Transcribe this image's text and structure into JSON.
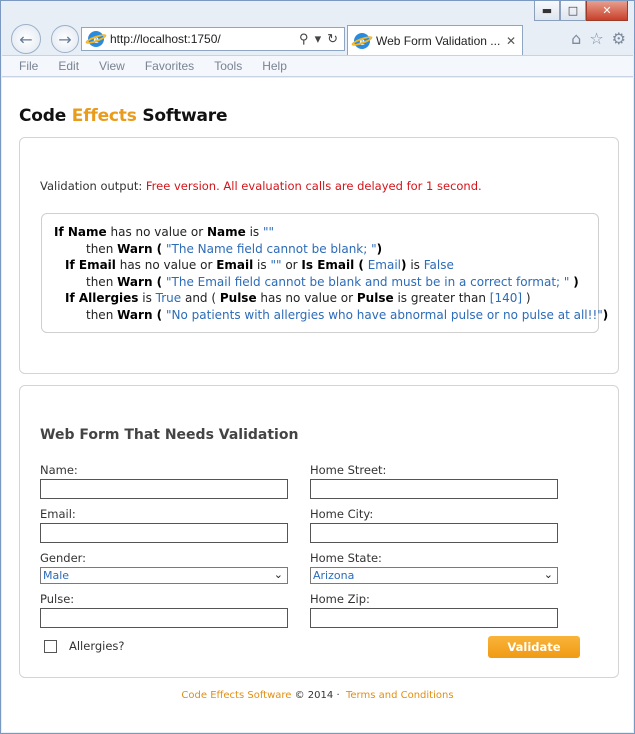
{
  "browser": {
    "url": "http://localhost:1750/",
    "tab_title": "Web Form Validation ...",
    "menu": [
      "File",
      "Edit",
      "View",
      "Favorites",
      "Tools",
      "Help"
    ]
  },
  "brand": {
    "part1": "Code ",
    "part2": "Effects",
    "part3": " Software"
  },
  "validation": {
    "label": "Validation output:",
    "message": "Free version. All evaluation calls are delayed for 1 second."
  },
  "rules": [
    {
      "if": "If ",
      "f1": "Name",
      "t1": " has no value or ",
      "f2": "Name",
      "t2": " is ",
      "v1": "\"\""
    },
    {
      "then": "then ",
      "warn": "Warn (",
      "msg": "\"The Name field cannot be blank; \"",
      "close": ")"
    },
    {
      "if": "If ",
      "f1": "Email",
      "t1": " has no value or ",
      "f2": "Email",
      "t2": " is ",
      "v1": "\"\"",
      "t3": " or ",
      "f3": "Is Email (",
      "v2": "Email",
      "f4": ")",
      "t4": " is ",
      "v3": "False"
    },
    {
      "then": "then ",
      "warn": "Warn (",
      "msg": "\"The Email field cannot be blank and must be in a correct format; \"",
      "close": ")"
    },
    {
      "if": "If ",
      "f1": "Allergies",
      "t1": " is ",
      "v1": "True",
      "t2": " and ( ",
      "f2": "Pulse",
      "t3": " has no value or ",
      "f3": "Pulse",
      "t4": " is greater than ",
      "v2": "[140]",
      "t5": " )"
    },
    {
      "then": "then ",
      "warn": "Warn (",
      "msg": "\"No patients with allergies who have abnormal pulse or no pulse at all!!\"",
      "close": ")"
    }
  ],
  "form": {
    "title": "Web Form That Needs Validation",
    "name_label": "Name:",
    "email_label": "Email:",
    "gender_label": "Gender:",
    "gender_value": "Male",
    "pulse_label": "Pulse:",
    "street_label": "Home Street:",
    "city_label": "Home City:",
    "state_label": "Home State:",
    "state_value": "Arizona",
    "zip_label": "Home Zip:",
    "allergies_label": "Allergies?",
    "validate_label": "Validate"
  },
  "footer": {
    "company": "Code Effects Software",
    "copyright": " © 2014 ",
    "dot": "·",
    "terms": "Terms and Conditions"
  }
}
